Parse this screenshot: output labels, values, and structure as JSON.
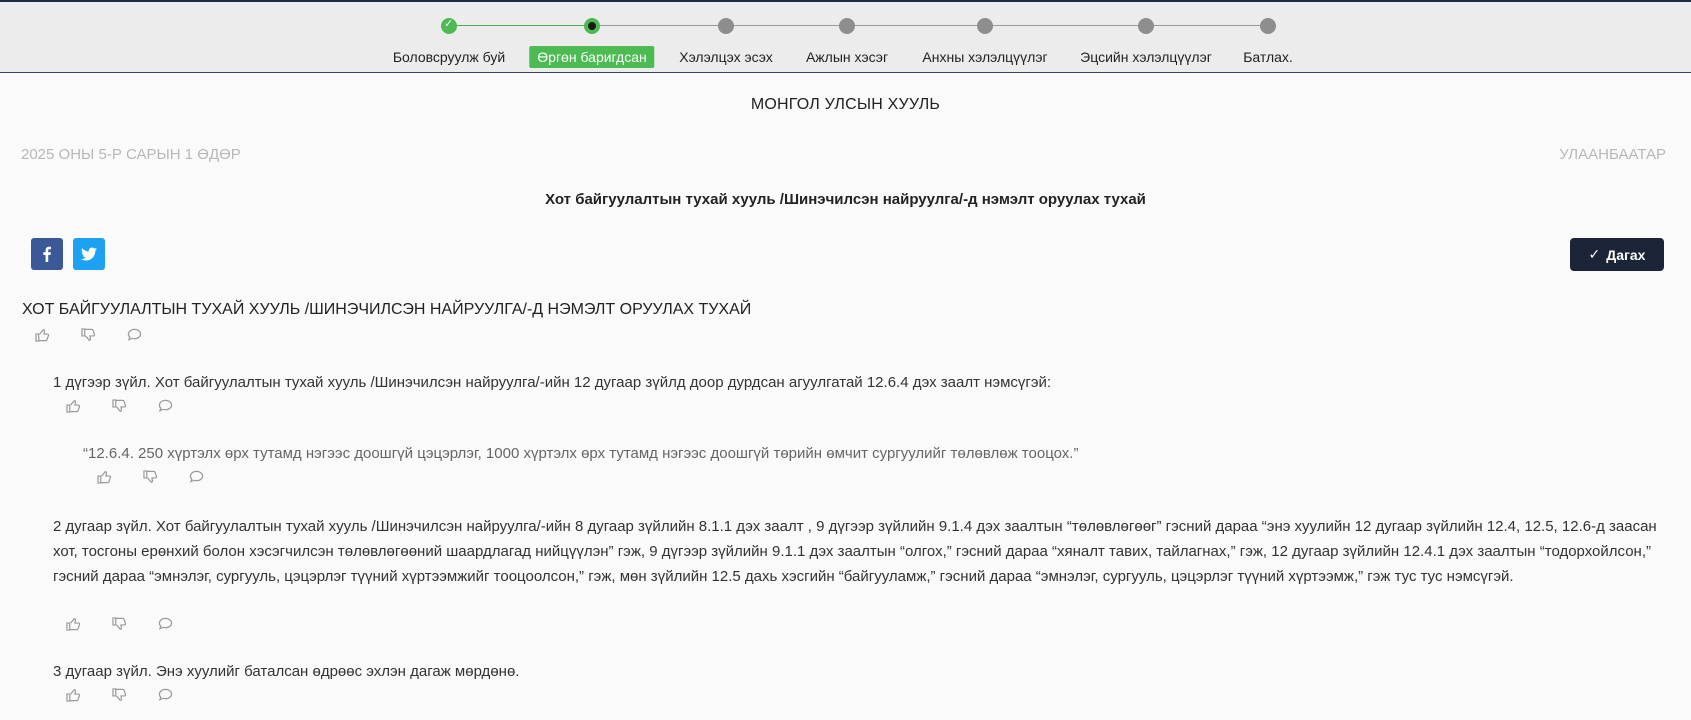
{
  "stepper": {
    "steps": [
      {
        "label": "Боловсруулж буй",
        "status": "done"
      },
      {
        "label": "Өргөн баригдсан",
        "status": "current"
      },
      {
        "label": "Хэлэлцэх эсэх",
        "status": "pending"
      },
      {
        "label": "Ажлын хэсэг",
        "status": "pending"
      },
      {
        "label": "Анхны хэлэлцүүлэг",
        "status": "pending"
      },
      {
        "label": "Эцсийн хэлэлцүүлэг",
        "status": "pending"
      },
      {
        "label": "Батлах.",
        "status": "pending"
      }
    ]
  },
  "document": {
    "header": "МОНГОЛ УЛСЫН ХУУЛЬ",
    "date": "2025 ОНЫ 5-Р САРЫН 1 ӨДӨР",
    "city": "УЛААНБААТАР",
    "title": "Хот байгуулалтын тухай хууль /Шинэчилсэн найруулга/-д нэмэлт оруулах тухай",
    "follow_label": "Дагах",
    "block_title": "ХОТ БАЙГУУЛАЛТЫН ТУХАЙ ХУУЛЬ /ШИНЭЧИЛСЭН НАЙРУУЛГА/-Д НЭМЭЛТ ОРУУЛАХ ТУХАЙ",
    "paragraphs": [
      "1 дүгээр зүйл. Хот байгуулалтын тухай хууль /Шинэчилсэн найруулга/-ийн 12 дугаар зүйлд доор дурдсан агуулгатай 12.6.4 дэх заалт нэмсүгэй:",
      "“12.6.4. 250 хүртэлх өрх тутамд нэгээс доошгүй цэцэрлэг, 1000 хүртэлх өрх тутамд нэгээс доошгүй төрийн өмчит сургуулийг төлөвлөж тооцох.”",
      "2 дугаар зүйл. Хот байгуулалтын тухай хууль /Шинэчилсэн найруулга/-ийн 8 дугаар зүйлийн 8.1.1 дэх заалт , 9 дүгээр зүйлийн 9.1.4 дэх заалтын “төлөвлөгөөг” гэсний дараа “энэ хуулийн 12 дугаар зүйлийн 12.4, 12.5, 12.6-д заасан хот, тосгоны ерөнхий болон хэсэгчилсэн төлөвлөгөөний шаардлагад нийцүүлэн” гэж, 9 дүгээр зүйлийн 9.1.1 дэх заалтын “олгох,” гэсний дараа “хяналт тавих, тайлагнах,” гэж, 12 дугаар зүйлийн 12.4.1 дэх заалтын “тодорхойлсон,” гэсний дараа “эмнэлэг, сургууль, цэцэрлэг түүний хүртээмжийг тооцоолсон,” гэж, мөн зүйлийн 12.5 дахь хэсгийн “байгууламж,” гэсний дараа “эмнэлэг, сургууль, цэцэрлэг түүний хүртээмж,” гэж тус тус нэмсүгэй.",
      "3 дугаар зүйл. Энэ хуулийг баталсан өдрөөс эхлэн дагаж мөрдөнө."
    ]
  },
  "icons": {
    "share_facebook": "facebook-icon",
    "share_twitter": "twitter-icon",
    "like": "thumbs-up-icon",
    "dislike": "thumbs-down-icon",
    "comment": "comment-icon"
  },
  "colors": {
    "step_done": "#4cbb52",
    "step_pending": "#8e8e8e",
    "facebook": "#3b5998",
    "twitter": "#1da1f2",
    "follow_button": "#1c2438"
  }
}
